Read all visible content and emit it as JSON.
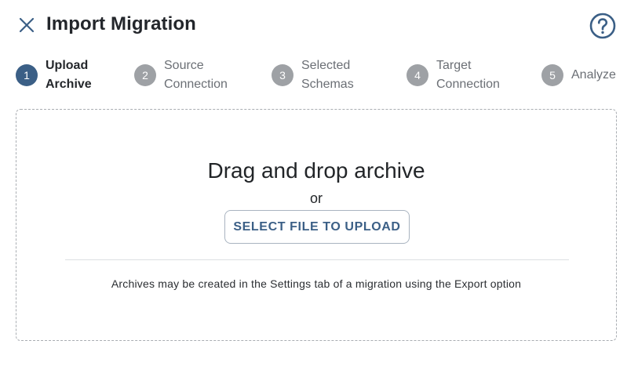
{
  "header": {
    "title": "Import Migration",
    "close_icon": "close-icon",
    "help_icon": "help-icon"
  },
  "stepper": {
    "steps": [
      {
        "number": "1",
        "line1": "Upload",
        "line2": "Archive",
        "active": true
      },
      {
        "number": "2",
        "line1": "Source",
        "line2": "Connection",
        "active": false
      },
      {
        "number": "3",
        "line1": "Selected",
        "line2": "Schemas",
        "active": false
      },
      {
        "number": "4",
        "line1": "Target",
        "line2": "Connection",
        "active": false
      },
      {
        "number": "5",
        "line1": "Analyze",
        "line2": "",
        "active": false
      }
    ]
  },
  "dropzone": {
    "title": "Drag and drop archive",
    "or_text": "or",
    "select_button_label": "SELECT FILE TO UPLOAD",
    "hint": "Archives may be created in the Settings tab of a migration using the Export option"
  },
  "colors": {
    "accent": "#3b5f86",
    "inactive_step": "#9ea1a5",
    "border": "#a9adb2"
  }
}
